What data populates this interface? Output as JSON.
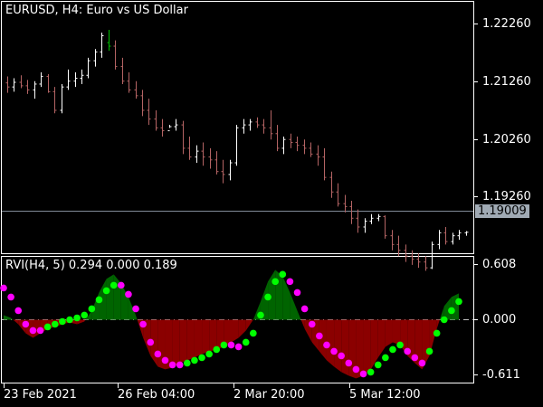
{
  "header": {
    "title": "EURUSD, H4:  Euro vs US Dollar"
  },
  "indicator": {
    "title": "RVI(H4, 5) 0.294 0.000 0.189"
  },
  "price_axis": {
    "ticks": [
      "1.22260",
      "1.21260",
      "1.20260",
      "1.19260"
    ],
    "current_price": "1.19009"
  },
  "rvi_axis": {
    "ticks": [
      "0.608",
      "0.000",
      "-0.611"
    ]
  },
  "time_axis": {
    "ticks": [
      "23 Feb 2021",
      "26 Feb 04:00",
      "2 Mar 20:00",
      "5 Mar 12:00"
    ]
  },
  "colors": {
    "background": "#000000",
    "frame": "#ffffff",
    "bear_candle": "#b46464",
    "bull_candle": "#ffffff",
    "highlight_candle": "#00c000",
    "rvi_positive_fill": "#006400",
    "rvi_negative_fill": "#8b0000",
    "dot_magenta": "#ff00ff",
    "dot_green": "#00ff00",
    "current_line": "#808a96"
  },
  "chart_data": [
    {
      "type": "candlestick",
      "title": "EURUSD, H4:  Euro vs US Dollar",
      "ylim": [
        1.1865,
        1.2296
      ],
      "ohlc": [
        [
          1.2157,
          1.2168,
          1.214,
          1.215
        ],
        [
          1.215,
          1.2165,
          1.2142,
          1.2158
        ],
        [
          1.2158,
          1.217,
          1.2148,
          1.2152
        ],
        [
          1.2152,
          1.2162,
          1.2138,
          1.2145
        ],
        [
          1.2145,
          1.216,
          1.213,
          1.2155
        ],
        [
          1.2155,
          1.2175,
          1.215,
          1.2168
        ],
        [
          1.2168,
          1.2172,
          1.214,
          1.2142
        ],
        [
          1.2142,
          1.215,
          1.2105,
          1.211
        ],
        [
          1.211,
          1.2155,
          1.2105,
          1.215
        ],
        [
          1.215,
          1.218,
          1.2145,
          1.216
        ],
        [
          1.216,
          1.2175,
          1.215,
          1.2165
        ],
        [
          1.2165,
          1.218,
          1.2155,
          1.217
        ],
        [
          1.217,
          1.22,
          1.2165,
          1.2195
        ],
        [
          1.2195,
          1.2215,
          1.2185,
          1.221
        ],
        [
          1.221,
          1.2243,
          1.22,
          1.2238
        ],
        [
          1.2226,
          1.2248,
          1.2212,
          1.222
        ],
        [
          1.222,
          1.223,
          1.218,
          1.2185
        ],
        [
          1.2185,
          1.22,
          1.2155,
          1.216
        ],
        [
          1.216,
          1.2175,
          1.214,
          1.2145
        ],
        [
          1.2145,
          1.216,
          1.213,
          1.2135
        ],
        [
          1.2135,
          1.2145,
          1.21,
          1.211
        ],
        [
          1.211,
          1.213,
          1.2085,
          1.2095
        ],
        [
          1.2095,
          1.211,
          1.2075,
          1.208
        ],
        [
          1.208,
          1.2095,
          1.2065,
          1.2075
        ],
        [
          1.2075,
          1.2085,
          1.208,
          1.2082
        ],
        [
          1.2082,
          1.2095,
          1.2075,
          1.2085
        ],
        [
          1.2085,
          1.2092,
          1.2035,
          1.2045
        ],
        [
          1.2045,
          1.2065,
          1.2025,
          1.203
        ],
        [
          1.203,
          1.205,
          1.202,
          1.204
        ],
        [
          1.204,
          1.2055,
          1.2015,
          1.203
        ],
        [
          1.203,
          1.2045,
          1.201,
          1.2025
        ],
        [
          1.2025,
          1.204,
          1.2,
          1.2005
        ],
        [
          1.2005,
          1.2025,
          1.1985,
          1.2
        ],
        [
          1.2,
          1.2025,
          1.199,
          1.202
        ],
        [
          1.202,
          1.2085,
          1.2015,
          1.208
        ],
        [
          1.208,
          1.2095,
          1.207,
          1.2085
        ],
        [
          1.2085,
          1.2095,
          1.2075,
          1.209
        ],
        [
          1.209,
          1.2098,
          1.208,
          1.2085
        ],
        [
          1.2085,
          1.2095,
          1.207,
          1.208
        ],
        [
          1.208,
          1.211,
          1.206,
          1.207
        ],
        [
          1.207,
          1.2085,
          1.204,
          1.2045
        ],
        [
          1.2045,
          1.2065,
          1.2035,
          1.206
        ],
        [
          1.206,
          1.207,
          1.2045,
          1.2055
        ],
        [
          1.2055,
          1.2065,
          1.204,
          1.205
        ],
        [
          1.205,
          1.206,
          1.2035,
          1.2045
        ],
        [
          1.2045,
          1.2055,
          1.203,
          1.2035
        ],
        [
          1.2035,
          1.205,
          1.2015,
          1.203
        ],
        [
          1.203,
          1.2045,
          1.199,
          1.1995
        ],
        [
          1.1995,
          1.2005,
          1.196,
          1.197
        ],
        [
          1.197,
          1.1985,
          1.1945,
          1.195
        ],
        [
          1.195,
          1.1965,
          1.1935,
          1.1945
        ],
        [
          1.1945,
          1.1955,
          1.1915,
          1.1925
        ],
        [
          1.1925,
          1.194,
          1.19,
          1.191
        ],
        [
          1.191,
          1.1925,
          1.19,
          1.192
        ],
        [
          1.192,
          1.1932,
          1.1915,
          1.1925
        ],
        [
          1.1925,
          1.1932,
          1.192,
          1.1928
        ],
        [
          1.1928,
          1.193,
          1.189,
          1.1895
        ],
        [
          1.1895,
          1.1905,
          1.187,
          1.188
        ],
        [
          1.188,
          1.1895,
          1.186,
          1.187
        ],
        [
          1.187,
          1.188,
          1.185,
          1.186
        ],
        [
          1.186,
          1.187,
          1.1845,
          1.1855
        ],
        [
          1.1855,
          1.1865,
          1.184,
          1.185
        ],
        [
          1.185,
          1.186,
          1.1835,
          1.184
        ],
        [
          1.184,
          1.1885,
          1.1838,
          1.188
        ],
        [
          1.188,
          1.1905,
          1.1872,
          1.19
        ],
        [
          1.19,
          1.191,
          1.188,
          1.1885
        ],
        [
          1.1885,
          1.19,
          1.188,
          1.1895
        ],
        [
          1.1895,
          1.1905,
          1.1888,
          1.19
        ],
        [
          1.19,
          1.1903,
          1.1895,
          1.1901
        ]
      ],
      "current_price": 1.19009
    },
    {
      "type": "line",
      "title": "RVI(H4, 5) 0.294 0.000 0.189",
      "ylim": [
        -0.75,
        0.75
      ],
      "ticks": [
        0.608,
        0.0,
        -0.611
      ],
      "series": [
        {
          "values": [
            0.05,
            0.02,
            -0.05,
            -0.15,
            -0.2,
            -0.15,
            -0.1,
            -0.08,
            -0.05,
            -0.03,
            -0.05,
            -0.02,
            0.1,
            0.3,
            0.45,
            0.5,
            0.4,
            0.25,
            0.05,
            -0.2,
            -0.4,
            -0.52,
            -0.55,
            -0.53,
            -0.48,
            -0.45,
            -0.42,
            -0.38,
            -0.35,
            -0.33,
            -0.3,
            -0.25,
            -0.2,
            -0.12,
            0.0,
            0.2,
            0.42,
            0.55,
            0.48,
            0.3,
            0.1,
            -0.1,
            -0.25,
            -0.35,
            -0.45,
            -0.52,
            -0.58,
            -0.62,
            -0.65,
            -0.62,
            -0.55,
            -0.42,
            -0.3,
            -0.25,
            -0.28,
            -0.4,
            -0.48,
            -0.55,
            -0.4,
            -0.1,
            0.15,
            0.25,
            0.29
          ]
        },
        {
          "values": [
            0.35,
            0.25,
            0.1,
            -0.05,
            -0.12,
            -0.12,
            -0.08,
            -0.05,
            -0.02,
            0.0,
            0.02,
            0.05,
            0.12,
            0.22,
            0.32,
            0.38,
            0.38,
            0.28,
            0.12,
            -0.05,
            -0.25,
            -0.38,
            -0.45,
            -0.5,
            -0.5,
            -0.48,
            -0.45,
            -0.42,
            -0.38,
            -0.33,
            -0.28,
            -0.28,
            -0.3,
            -0.25,
            -0.15,
            0.05,
            0.25,
            0.42,
            0.5,
            0.42,
            0.3,
            0.12,
            -0.05,
            -0.18,
            -0.28,
            -0.35,
            -0.4,
            -0.48,
            -0.55,
            -0.6,
            -0.58,
            -0.5,
            -0.42,
            -0.33,
            -0.28,
            -0.35,
            -0.42,
            -0.48,
            -0.35,
            -0.15,
            0.0,
            0.1,
            0.2
          ]
        }
      ]
    }
  ]
}
